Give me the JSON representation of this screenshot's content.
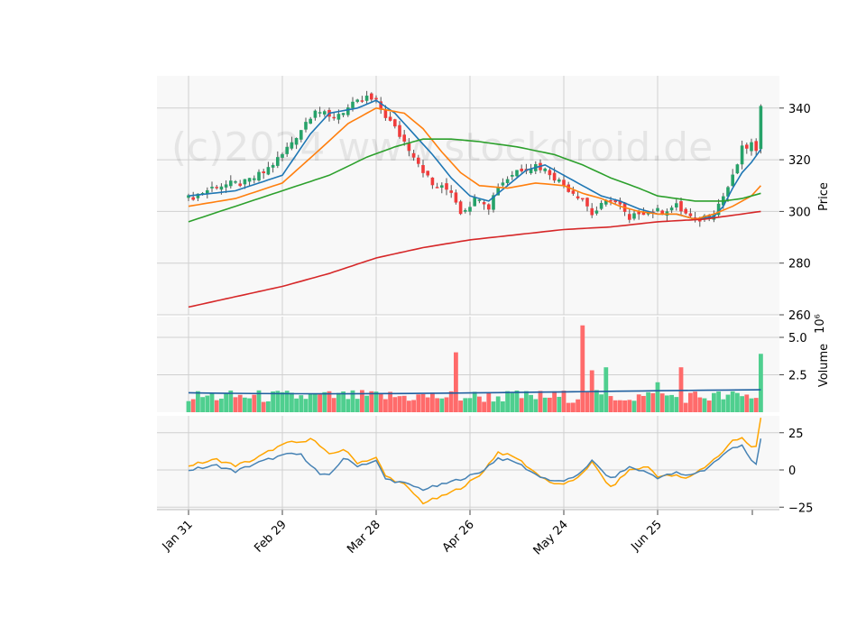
{
  "watermark": "(c)2024 www.stockdroid.de",
  "colors": {
    "up": "#26a269",
    "down": "#f03c3c",
    "up_vol": "#4fcf8f",
    "down_vol": "#ff6b6b",
    "ma_fast": "#1f77b4",
    "ma_mid": "#ff7f0e",
    "ma_slow": "#2ca02c",
    "ma_long": "#d62728",
    "osc_a": "#4682b4",
    "osc_b": "#ffa500",
    "vol_ma": "#1f5f9f",
    "panel_bg": "#f8f8f8",
    "grid": "#d0d0d0"
  },
  "chart_data": [
    {
      "type": "candlestick",
      "ylabel": "Price",
      "ylim": [
        260,
        348
      ],
      "yticks": [
        260,
        280,
        300,
        320,
        340
      ],
      "grid": true,
      "x_tick_labels": [
        "Jan 31",
        "Feb 29",
        "Mar 28",
        "Apr 26",
        "May 24",
        "Jun 25"
      ],
      "x_tick_index": [
        0,
        20,
        40,
        60,
        80,
        100
      ],
      "n_points": 121,
      "close_keypoints": [
        [
          0,
          305
        ],
        [
          6,
          310
        ],
        [
          12,
          311
        ],
        [
          16,
          315
        ],
        [
          20,
          322
        ],
        [
          24,
          332
        ],
        [
          27,
          340
        ],
        [
          30,
          336
        ],
        [
          34,
          340
        ],
        [
          38,
          344
        ],
        [
          40,
          342
        ],
        [
          44,
          332
        ],
        [
          48,
          322
        ],
        [
          52,
          310
        ],
        [
          56,
          308
        ],
        [
          58,
          300
        ],
        [
          62,
          306
        ],
        [
          64,
          302
        ],
        [
          66,
          310
        ],
        [
          70,
          316
        ],
        [
          74,
          318
        ],
        [
          77,
          315
        ],
        [
          80,
          310
        ],
        [
          84,
          305
        ],
        [
          86,
          299
        ],
        [
          90,
          305
        ],
        [
          92,
          302
        ],
        [
          94,
          296
        ],
        [
          96,
          300
        ],
        [
          100,
          300
        ],
        [
          104,
          302
        ],
        [
          108,
          296
        ],
        [
          112,
          300
        ],
        [
          114,
          306
        ],
        [
          116,
          313
        ],
        [
          118,
          324
        ],
        [
          120,
          326
        ],
        [
          121,
          322
        ],
        [
          122,
          342
        ]
      ],
      "ma_lines": [
        {
          "key": "ma_fast",
          "keypoints": [
            [
              0,
              306
            ],
            [
              10,
              308
            ],
            [
              20,
              314
            ],
            [
              26,
              330
            ],
            [
              30,
              338
            ],
            [
              36,
              340
            ],
            [
              40,
              343
            ],
            [
              44,
              338
            ],
            [
              48,
              330
            ],
            [
              52,
              322
            ],
            [
              56,
              313
            ],
            [
              60,
              306
            ],
            [
              64,
              304
            ],
            [
              68,
              310
            ],
            [
              72,
              316
            ],
            [
              76,
              318
            ],
            [
              80,
              314
            ],
            [
              84,
              310
            ],
            [
              88,
              306
            ],
            [
              92,
              304
            ],
            [
              96,
              301
            ],
            [
              100,
              299
            ],
            [
              104,
              299
            ],
            [
              108,
              297
            ],
            [
              112,
              298
            ],
            [
              114,
              302
            ],
            [
              116,
              309
            ],
            [
              118,
              315
            ],
            [
              120,
              319
            ],
            [
              122,
              324
            ]
          ]
        },
        {
          "key": "ma_mid",
          "keypoints": [
            [
              0,
              302
            ],
            [
              10,
              305
            ],
            [
              20,
              311
            ],
            [
              28,
              324
            ],
            [
              34,
              334
            ],
            [
              40,
              340
            ],
            [
              46,
              338
            ],
            [
              50,
              332
            ],
            [
              54,
              323
            ],
            [
              58,
              315
            ],
            [
              62,
              310
            ],
            [
              68,
              309
            ],
            [
              74,
              311
            ],
            [
              80,
              310
            ],
            [
              84,
              307
            ],
            [
              88,
              305
            ],
            [
              92,
              302
            ],
            [
              96,
              300
            ],
            [
              100,
              299
            ],
            [
              104,
              299
            ],
            [
              108,
              297
            ],
            [
              112,
              299
            ],
            [
              116,
              302
            ],
            [
              120,
              306
            ],
            [
              122,
              310
            ]
          ]
        },
        {
          "key": "ma_slow",
          "keypoints": [
            [
              0,
              296
            ],
            [
              10,
              302
            ],
            [
              20,
              308
            ],
            [
              30,
              314
            ],
            [
              38,
              321
            ],
            [
              44,
              325
            ],
            [
              50,
              328
            ],
            [
              56,
              328
            ],
            [
              62,
              327
            ],
            [
              70,
              325
            ],
            [
              78,
              322
            ],
            [
              84,
              318
            ],
            [
              90,
              313
            ],
            [
              96,
              309
            ],
            [
              100,
              306
            ],
            [
              104,
              305
            ],
            [
              108,
              304
            ],
            [
              114,
              304
            ],
            [
              118,
              305
            ],
            [
              122,
              307
            ]
          ]
        },
        {
          "key": "ma_long",
          "keypoints": [
            [
              0,
              263
            ],
            [
              10,
              267
            ],
            [
              20,
              271
            ],
            [
              30,
              276
            ],
            [
              40,
              282
            ],
            [
              50,
              286
            ],
            [
              60,
              289
            ],
            [
              70,
              291
            ],
            [
              80,
              293
            ],
            [
              90,
              294
            ],
            [
              100,
              296
            ],
            [
              110,
              297
            ],
            [
              122,
              300
            ]
          ]
        }
      ]
    },
    {
      "type": "bar",
      "ylabel": "Volume",
      "ylabel_exponent": "10⁶",
      "ylim": [
        0,
        6.2
      ],
      "yticks": [
        2.5,
        5.0
      ],
      "ytick_labels": [
        "2.5",
        "5.0"
      ],
      "vol_ma_level": 1.3,
      "spikes": [
        [
          57,
          4.0
        ],
        [
          84,
          5.8
        ],
        [
          86,
          2.8
        ],
        [
          89,
          3.0
        ],
        [
          100,
          2.0
        ],
        [
          105,
          3.0
        ],
        [
          122,
          3.9
        ]
      ]
    },
    {
      "type": "line",
      "ylim": [
        -27,
        30
      ],
      "yticks": [
        -25,
        0,
        25
      ],
      "ytick_labels": [
        "−25",
        "0",
        "25"
      ],
      "series_a_keypoints": [
        [
          0,
          0
        ],
        [
          6,
          3
        ],
        [
          10,
          -1
        ],
        [
          14,
          4
        ],
        [
          18,
          8
        ],
        [
          22,
          11
        ],
        [
          24,
          10
        ],
        [
          26,
          4
        ],
        [
          28,
          -3
        ],
        [
          30,
          -4
        ],
        [
          33,
          8
        ],
        [
          36,
          3
        ],
        [
          40,
          6
        ],
        [
          42,
          -6
        ],
        [
          46,
          -9
        ],
        [
          50,
          -13
        ],
        [
          54,
          -10
        ],
        [
          58,
          -6
        ],
        [
          62,
          -2
        ],
        [
          66,
          8
        ],
        [
          70,
          5
        ],
        [
          74,
          -3
        ],
        [
          78,
          -8
        ],
        [
          82,
          -6
        ],
        [
          86,
          6
        ],
        [
          90,
          -6
        ],
        [
          94,
          2
        ],
        [
          98,
          -2
        ],
        [
          100,
          -5
        ],
        [
          104,
          -2
        ],
        [
          106,
          -4
        ],
        [
          110,
          0
        ],
        [
          114,
          10
        ],
        [
          116,
          15
        ],
        [
          118,
          17
        ],
        [
          120,
          6
        ],
        [
          121,
          3
        ],
        [
          122,
          21
        ]
      ],
      "series_b_keypoints": [
        [
          0,
          3
        ],
        [
          6,
          7
        ],
        [
          10,
          3
        ],
        [
          14,
          7
        ],
        [
          18,
          14
        ],
        [
          22,
          19
        ],
        [
          24,
          18
        ],
        [
          26,
          22
        ],
        [
          28,
          16
        ],
        [
          30,
          10
        ],
        [
          33,
          14
        ],
        [
          36,
          5
        ],
        [
          40,
          8
        ],
        [
          42,
          -4
        ],
        [
          46,
          -10
        ],
        [
          50,
          -22
        ],
        [
          54,
          -18
        ],
        [
          58,
          -12
        ],
        [
          62,
          -4
        ],
        [
          66,
          12
        ],
        [
          70,
          8
        ],
        [
          74,
          -2
        ],
        [
          78,
          -10
        ],
        [
          82,
          -8
        ],
        [
          86,
          5
        ],
        [
          90,
          -12
        ],
        [
          94,
          0
        ],
        [
          98,
          2
        ],
        [
          100,
          -4
        ],
        [
          104,
          -4
        ],
        [
          106,
          -6
        ],
        [
          110,
          2
        ],
        [
          114,
          12
        ],
        [
          116,
          20
        ],
        [
          118,
          22
        ],
        [
          120,
          15
        ],
        [
          121,
          15
        ],
        [
          122,
          35
        ]
      ]
    }
  ]
}
